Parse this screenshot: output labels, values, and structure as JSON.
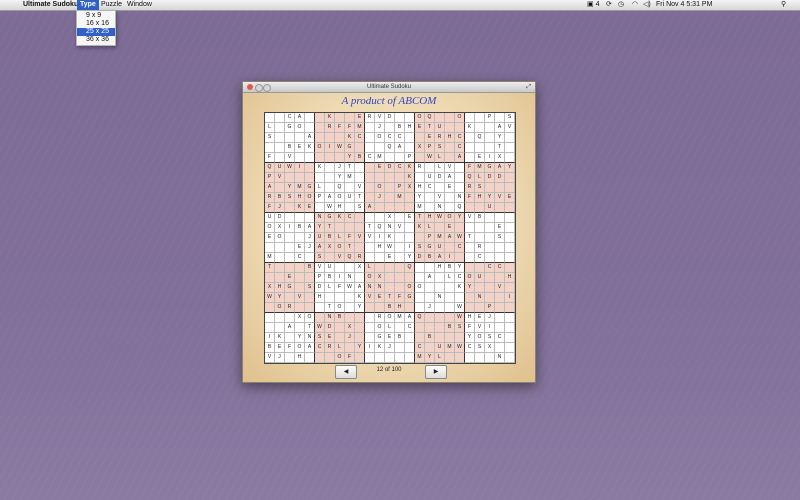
{
  "menubar": {
    "app_name": "Ultimate Sudoku",
    "menus": [
      "Type",
      "Puzzle",
      "Window"
    ],
    "status": {
      "badge": "4",
      "datetime": "Fri Nov 4  5:31 PM"
    }
  },
  "type_menu": {
    "options": [
      "9 x 9",
      "16 x 16",
      "25 x 25",
      "36 x 36"
    ],
    "selected_index": 2
  },
  "window": {
    "title": "Ultimate Sudoku",
    "headline": "A product of ABCOM",
    "prev_label": "◀",
    "next_label": "▶",
    "counter": "12 of 100"
  },
  "colors": {
    "shade": "#f3d3c8",
    "headline": "#3044c4",
    "desktop": "#7e6e96"
  },
  "sudoku": {
    "size": 25,
    "rows": [
      "  CA  K  ERVD  OQ  O  P S",
      "L GO  RFFM J BHETU  K  AV",
      "S   A   KC OCC  ERHC Q Y ",
      "  BEKOIWG   QA XPS C   T ",
      "F V     YBCM  P WL A EIX ",
      "QUWI K JT  EDCKR LV FMGAYH",
      "PV     YM     K UDA QLDD ",
      "A YMGL Q V O PXHC E RS   ",
      "RBSHOPAOUT J M Y V NFHYVE",
      "FJ KE WH SA    M N Q  U  ",
      "UD   NGKC   X ETHWOYVB   ",
      "OXIBAYT   TQNV KL E    E ",
      "EO  JUBLFVVIK   PMAWT  S ",
      "   EJAXOT  HW ISGU C R   ",
      "M  C S VQR  E YDBAI  C   ",
      "T   BVU  XL   Q  HBY  CC ",
      "  E  PBIN OX    A LCOU  H",
      "XHG SDLFWANN  OO   KY  V ",
      "WY V H   KVETFG  N   N  I",
      " OR   TO Y  BH  J  W  P  ",
      "   XO NB   ROMAQ   WHEJ  ",
      "  A TWD X  OL C   BSFVI  ",
      "IK YNSE J  GEB  B   YOSC ",
      "BEFOACRL YIKJ  C UMWCSX  ",
      "VJ H   OF      MYL     N "
    ]
  }
}
